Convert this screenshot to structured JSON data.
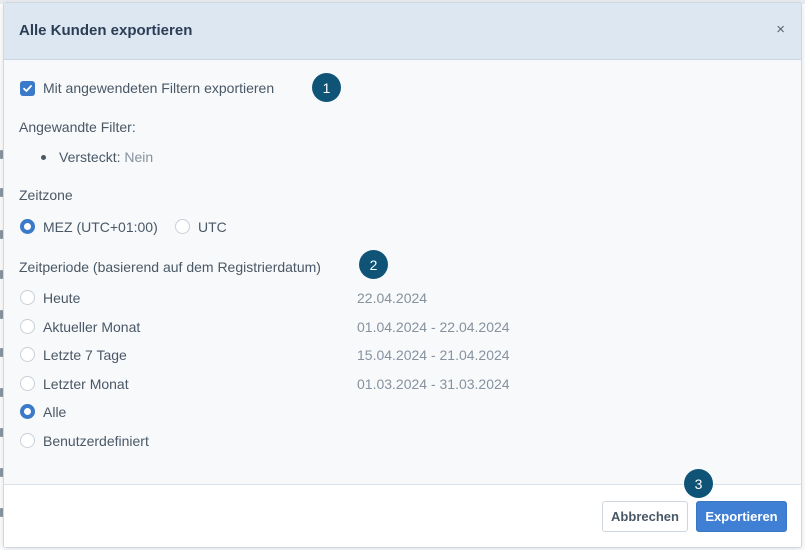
{
  "modal": {
    "title": "Alle Kunden exportieren",
    "close_label": "×"
  },
  "filter": {
    "checkbox_label": "Mit angewendeten Filtern exportieren",
    "checked": true,
    "applied_heading": "Angewandte Filter:",
    "applied_items": [
      {
        "name": "Versteckt:",
        "value": "Nein"
      }
    ]
  },
  "timezone": {
    "heading": "Zeitzone",
    "options": [
      {
        "label": "MEZ (UTC+01:00)",
        "selected": true
      },
      {
        "label": "UTC",
        "selected": false
      }
    ]
  },
  "period": {
    "heading": "Zeitperiode (basierend auf dem Registrierdatum)",
    "options": [
      {
        "label": "Heute",
        "range": "22.04.2024",
        "selected": false
      },
      {
        "label": "Aktueller Monat",
        "range": "01.04.2024 - 22.04.2024",
        "selected": false
      },
      {
        "label": "Letzte 7 Tage",
        "range": "15.04.2024 - 21.04.2024",
        "selected": false
      },
      {
        "label": "Letzter Monat",
        "range": "01.03.2024 - 31.03.2024",
        "selected": false
      },
      {
        "label": "Alle",
        "range": "",
        "selected": true
      },
      {
        "label": "Benutzerdefiniert",
        "range": "",
        "selected": false
      }
    ]
  },
  "badges": [
    "1",
    "2",
    "3"
  ],
  "footer": {
    "cancel_label": "Abbrechen",
    "export_label": "Exportieren"
  },
  "colors": {
    "accent": "#3b79c9",
    "badge": "#0f5477",
    "header_bg": "#dde7f2"
  }
}
